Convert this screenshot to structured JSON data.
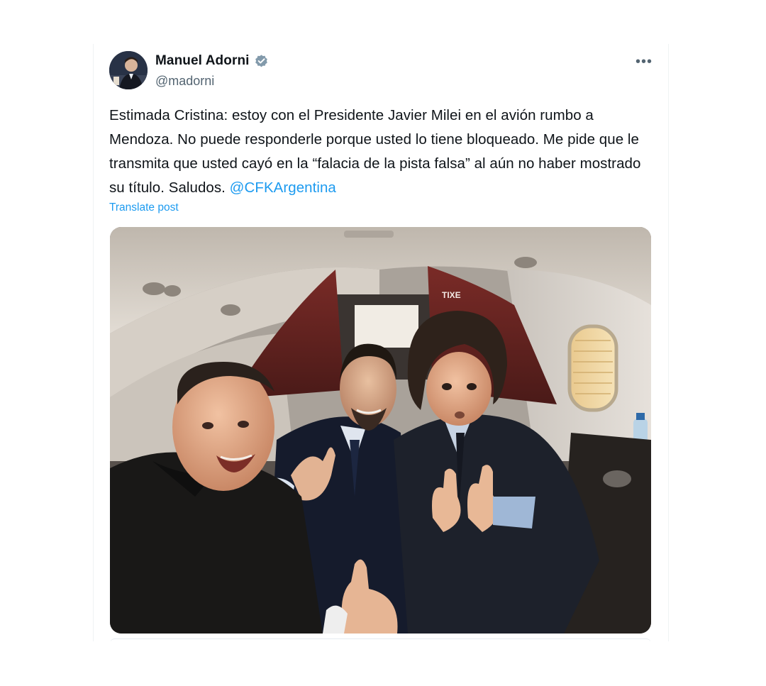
{
  "author": {
    "display_name": "Manuel Adorni",
    "handle": "@madorni",
    "verified_icon": "verified-badge-icon",
    "avatar_icon": "avatar"
  },
  "post": {
    "text_before_mention": "Estimada Cristina: estoy con el Presidente Javier Milei en el avión rumbo a Mendoza. No puede responderle porque usted lo tiene bloqueado. Me pide que le transmita que usted cayó en la “falacia de la pista falsa” al aún no haber mostrado su título. Saludos. ",
    "mention": "@CFKArgentina",
    "translate_label": "Translate post",
    "more_icon": "more-icon"
  },
  "media": {
    "sign_text": "TIXE"
  },
  "colors": {
    "text": "#0f1419",
    "secondary": "#536471",
    "link": "#1d9bf0",
    "verified": "#829aab"
  }
}
